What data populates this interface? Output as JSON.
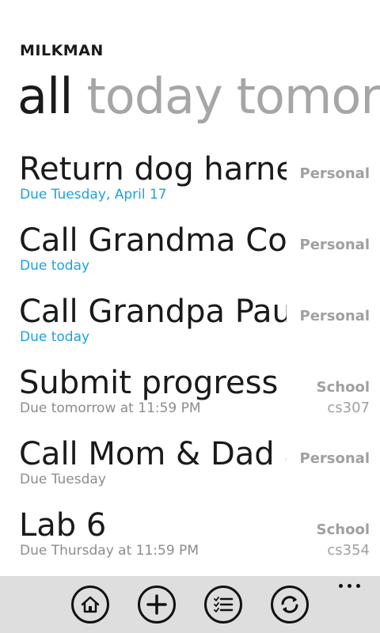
{
  "app": {
    "title": "MILKMAN"
  },
  "pivot": {
    "tabs": [
      {
        "label": "all",
        "active": true
      },
      {
        "label": "today",
        "active": false
      },
      {
        "label": "tomorrow",
        "active": false
      }
    ]
  },
  "tasks": [
    {
      "title": "Return dog harness",
      "due": "Due Tuesday, April 17",
      "list": "Personal",
      "tag": ""
    },
    {
      "title": "Call Grandma Connie",
      "due": "Due today",
      "list": "Personal",
      "tag": ""
    },
    {
      "title": "Call Grandpa Paul",
      "due": "Due today",
      "list": "Personal",
      "tag": ""
    },
    {
      "title": "Submit progress report",
      "due": "Due tomorrow at 11:59 PM",
      "list": "School",
      "tag": "cs307"
    },
    {
      "title": "Call Mom & Dad about",
      "due": "Due Tuesday",
      "list": "Personal",
      "tag": ""
    },
    {
      "title": "Lab 6",
      "due": "Due Thursday at 11:59 PM",
      "list": "School",
      "tag": "cs354"
    }
  ],
  "appbar": {
    "buttons": [
      {
        "icon": "home-icon"
      },
      {
        "icon": "add-icon"
      },
      {
        "icon": "list-icon"
      },
      {
        "icon": "sync-icon"
      }
    ],
    "more_icon": "more-dots-icon"
  },
  "colors": {
    "accent": "#1ba1e2",
    "text": "#1a1a1a",
    "secondary_text": "#8c8c8c",
    "inactive_tab": "#a6a6a6",
    "appbar_bg": "#dedede"
  }
}
